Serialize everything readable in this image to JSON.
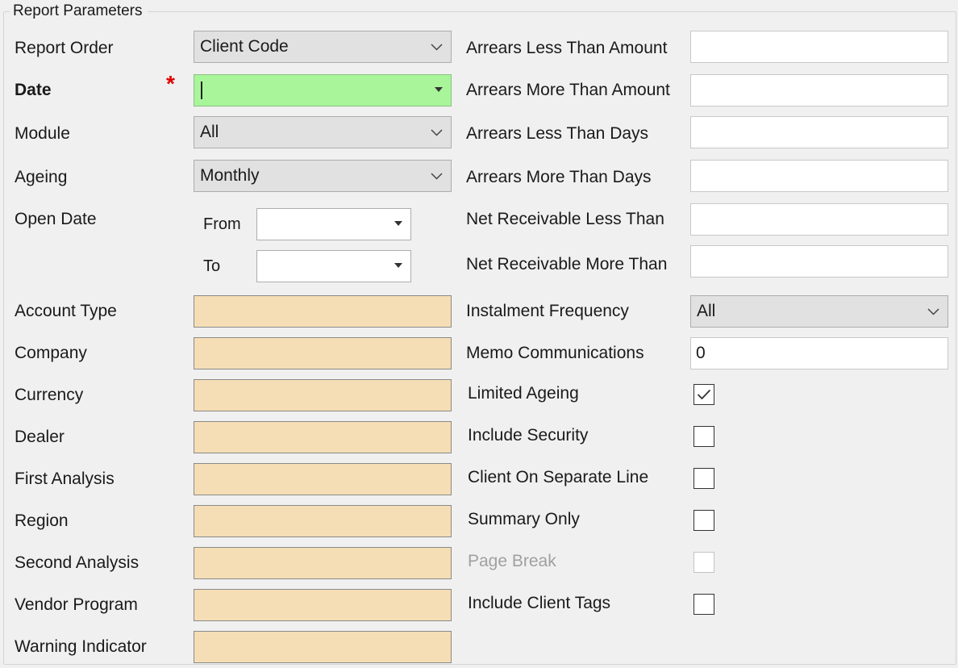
{
  "group": {
    "title": "Report Parameters"
  },
  "left": {
    "report_order": {
      "label": "Report Order",
      "value": "Client Code"
    },
    "date": {
      "label": "Date",
      "required_marker": "*",
      "value": ""
    },
    "module": {
      "label": "Module",
      "value": "All"
    },
    "ageing": {
      "label": "Ageing",
      "value": "Monthly"
    },
    "open_date": {
      "label": "Open Date",
      "from_label": "From",
      "to_label": "To",
      "from_value": "",
      "to_value": ""
    },
    "lookups": [
      {
        "label": "Account Type",
        "value": ""
      },
      {
        "label": "Company",
        "value": ""
      },
      {
        "label": "Currency",
        "value": ""
      },
      {
        "label": "Dealer",
        "value": ""
      },
      {
        "label": "First Analysis",
        "value": ""
      },
      {
        "label": "Region",
        "value": ""
      },
      {
        "label": "Second Analysis",
        "value": ""
      },
      {
        "label": "Vendor Program",
        "value": ""
      },
      {
        "label": "Warning Indicator",
        "value": ""
      }
    ]
  },
  "right": {
    "numeric_fields": [
      {
        "label": "Arrears Less Than Amount",
        "value": ""
      },
      {
        "label": "Arrears More Than Amount",
        "value": ""
      },
      {
        "label": "Arrears Less Than Days",
        "value": ""
      },
      {
        "label": "Arrears More Than Days",
        "value": ""
      },
      {
        "label": "Net Receivable Less Than",
        "value": ""
      },
      {
        "label": "Net Receivable More Than",
        "value": ""
      }
    ],
    "instalment_frequency": {
      "label": "Instalment Frequency",
      "value": "All"
    },
    "memo_communications": {
      "label": "Memo Communications",
      "value": "0"
    },
    "checkboxes": [
      {
        "label": "Limited Ageing",
        "checked": true,
        "enabled": true
      },
      {
        "label": "Include Security",
        "checked": false,
        "enabled": true
      },
      {
        "label": "Client On Separate Line",
        "checked": false,
        "enabled": true
      },
      {
        "label": "Summary Only",
        "checked": false,
        "enabled": true
      },
      {
        "label": "Page Break",
        "checked": false,
        "enabled": false
      },
      {
        "label": "Include Client Tags",
        "checked": false,
        "enabled": true
      }
    ]
  },
  "colors": {
    "required_field": "#a8f59a",
    "lookup_field": "#f5deb5",
    "required_marker": "#e00000"
  }
}
